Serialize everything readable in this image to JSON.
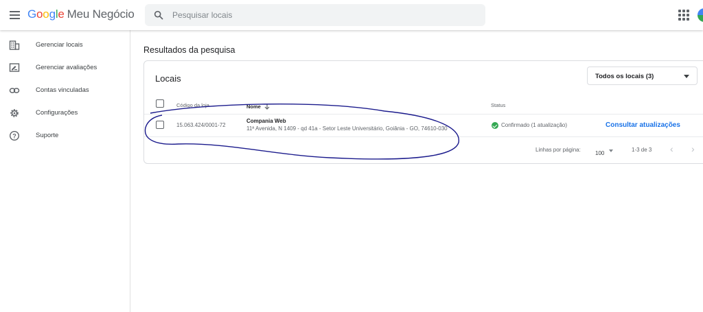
{
  "app": {
    "logo_letters": [
      "G",
      "o",
      "o",
      "g",
      "l",
      "e"
    ],
    "product": "Meu Negócio",
    "colors": {
      "blue": "#4285f4",
      "red": "#ea4335",
      "yellow": "#fbbc05",
      "green": "#34a853",
      "link": "#1a73e8"
    }
  },
  "search": {
    "placeholder": "Pesquisar locais",
    "value": ""
  },
  "sidebar": {
    "items": [
      {
        "label": "Gerenciar locais",
        "icon": "building-icon"
      },
      {
        "label": "Gerenciar avaliações",
        "icon": "review-icon"
      },
      {
        "label": "Contas vinculadas",
        "icon": "link-icon"
      },
      {
        "label": "Configurações",
        "icon": "gear-icon"
      },
      {
        "label": "Suporte",
        "icon": "help-icon"
      }
    ]
  },
  "main": {
    "title": "Resultados da pesquisa",
    "card_title": "Locais",
    "filter": {
      "selected": "Todos os locais (3)"
    },
    "table": {
      "headers": {
        "code": "Código da loja",
        "name": "Nome",
        "status": "Status"
      },
      "rows": [
        {
          "code": "15.063.424/0001-72",
          "name": "Compania Web",
          "address": "11ª Avenida, N 1409 - qd 41a - Setor Leste Universitário, Goiânia - GO, 74610-030",
          "status": "Confirmado (1 atualização)",
          "action": "Consultar atualizações"
        }
      ]
    },
    "pagination": {
      "rows_label": "Linhas por página:",
      "rows_value": "100",
      "range": "1-3 de 3"
    }
  }
}
